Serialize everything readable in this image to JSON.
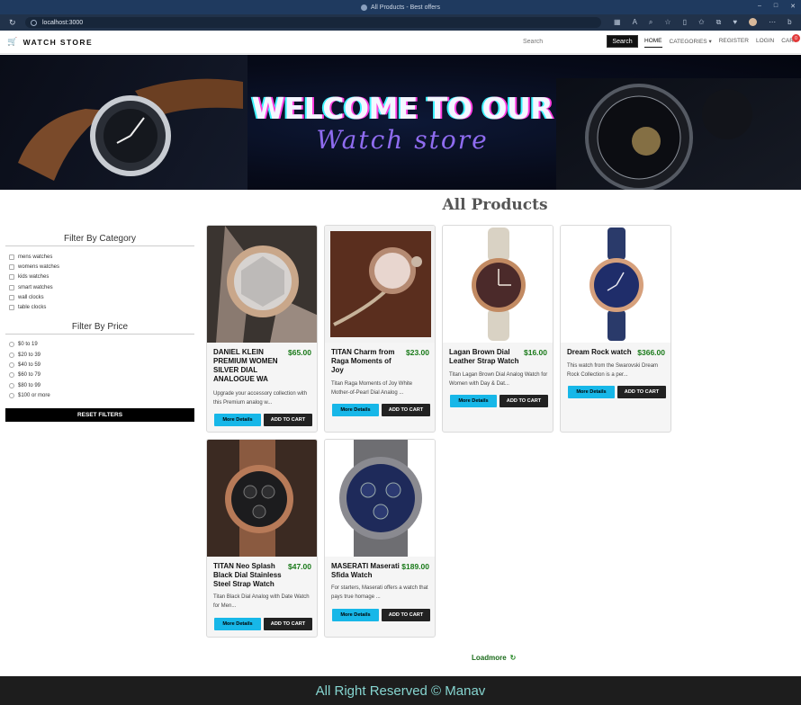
{
  "browser": {
    "tab_title": "All Products - Best offers",
    "url": "localhost:3000"
  },
  "nav": {
    "brand": "WATCH STORE",
    "search_placeholder": "Search",
    "search_button": "Search",
    "links": [
      "HOME",
      "CATEGORIES",
      "REGISTER",
      "LOGIN",
      "CART"
    ],
    "cart_count": "0"
  },
  "banner": {
    "title": "WELCOME TO OUR",
    "subtitle": "Watch store"
  },
  "main": {
    "title": "All Products",
    "loadmore": "Loadmore"
  },
  "sidebar": {
    "category_heading": "Filter By Category",
    "categories": [
      "mens watches",
      "womens watches",
      "kids watches",
      "smart watches",
      "wall clocks",
      "table clocks"
    ],
    "price_heading": "Filter By Price",
    "prices": [
      "$0 to 19",
      "$20 to 39",
      "$40 to 59",
      "$60 to 79",
      "$80 to 99",
      "$100 or more"
    ],
    "reset": "RESET FILTERS"
  },
  "products": [
    {
      "name": "DANIEL KLEIN PREMIUM WOMEN SILVER DIAL ANALOGUE WA",
      "price": "$65.00",
      "desc": "Upgrade your accessory collection with this Premium analog w...",
      "more": "More Details",
      "cart": "ADD TO CART"
    },
    {
      "name": "TITAN Charm from Raga Moments of Joy",
      "price": "$23.00",
      "desc": "Titan Raga Moments of Joy White Mother-of-Pearl Dial Analog ...",
      "more": "More Details",
      "cart": "ADD TO CART"
    },
    {
      "name": "Lagan Brown Dial Leather Strap Watch",
      "price": "$16.00",
      "desc": "Titan Lagan Brown Dial Analog Watch for Women with Day & Dat...",
      "more": "More Details",
      "cart": "ADD TO CART"
    },
    {
      "name": "Dream Rock watch",
      "price": "$366.00",
      "desc": "This watch from the Swarovski Dream Rock Collection is a per...",
      "more": "More Details",
      "cart": "ADD TO CART"
    },
    {
      "name": "TITAN Neo Splash Black Dial Stainless Steel Strap Watch",
      "price": "$47.00",
      "desc": "Titan Black Dial Analog with Date Watch for Men...",
      "more": "More Details",
      "cart": "ADD TO CART"
    },
    {
      "name": "MASERATI Maserati Sfida Watch",
      "price": "$189.00",
      "desc": "For starters, Maserati offers a watch that pays true homage ...",
      "more": "More Details",
      "cart": "ADD TO CART"
    }
  ],
  "footer": {
    "text": "All Right Reserved © Manav"
  },
  "colors": {
    "accent_button": "#17b7e8",
    "price_green": "#1a7a1a",
    "footer_bg": "#1d1d1d",
    "footer_text": "#86d5d0"
  }
}
